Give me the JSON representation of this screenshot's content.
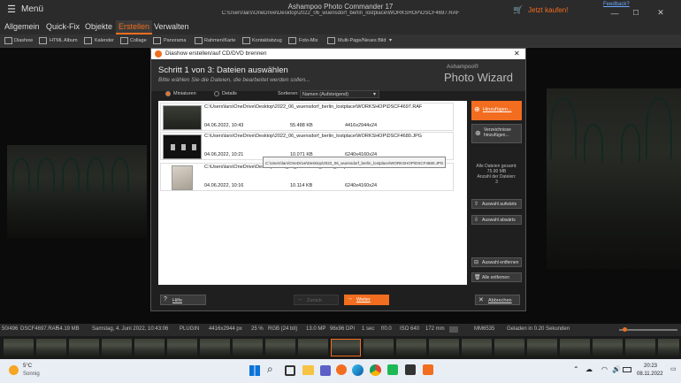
{
  "app": {
    "menu_label": "Menü",
    "window_title": "Ashampoo Photo Commander 17",
    "file_path": "C:\\Users\\lars\\OneDrive\\Desktop\\2022_06_wuensdorf_berlin_lostplace\\WORKSHOP\\DSCF4697.RAF",
    "buy_label": "Jetzt kaufen!",
    "feedback_label": "Feedback?"
  },
  "menu": [
    "Allgemein",
    "Quick-Fix",
    "Objekte",
    "Erstellen",
    "Verwalten"
  ],
  "toolbar": [
    "Diashow",
    "HTML Album",
    "Kalender",
    "Collage",
    "Panorama",
    "Rahmen/Karte",
    "Kontaktabzug",
    "Foto-Mix",
    "Multi-Page/Neues Bild"
  ],
  "dialog": {
    "title": "Diashow erstellen/auf CD/DVD brennen",
    "step": "Schritt 1 von 3: Dateien auswählen",
    "subtitle": "Bitte wählen Sie die Dateien, die bearbeitet werden sollen...",
    "brand_small": "Ashampoo®",
    "brand_large": "Photo Wizard",
    "view_thumbs": "Miniaturen",
    "view_details": "Details",
    "sort_label": "Sortieren:",
    "sort_value": "Namen (Aufsteigend)",
    "files": [
      {
        "path": "C:\\Users\\lars\\OneDrive\\Desktop\\2022_06_wuensdorf_berlin_lostplace\\WORKSHOP\\DSCF4697.RAF",
        "date": "04.06.2022, 10:43",
        "size": "55.488 KB",
        "dims": "4416x2944x24"
      },
      {
        "path": "C:\\Users\\lars\\OneDrive\\Desktop\\2022_06_wuensdorf_berlin_lostplace\\WORKSHOP\\DSCF4680.JPG",
        "date": "04.06.2022, 10:21",
        "size": "10.071 KB",
        "dims": "6240x4160x24"
      },
      {
        "path": "C:\\Users\\lars\\OneDrive\\Desktop\\2022_06_wuensdorf_berlin_lostplace\\WORKSHOP\\DSCF4673.JPG",
        "date": "04.06.2022, 10:16",
        "size": "10.114 KB",
        "dims": "6240x4160x24"
      }
    ],
    "tooltip": "C:\\Users\\lars\\OneDrive\\Desktop\\2022_06_wuensdorf_berlin_lostplace\\WORKSHOP\\DSCF4680.JPG",
    "add_files": "Hinzufügen...",
    "add_folder": "Verzeichnisse hinzufügen...",
    "info_all": "Alle Dateien gesamt:",
    "info_size": "75.90 MB",
    "info_count_label": "Anzahl der Dateien:",
    "info_count": "3",
    "move_up": "Auswahl aufwärts",
    "move_down": "Auswahl abwärts",
    "remove_sel": "Auswahl entfernen",
    "remove_all": "Alle entfernen",
    "help": "Hilfe",
    "back": "Zurück",
    "next": "Weiter",
    "cancel": "Abbrechen"
  },
  "status": {
    "index": "50/496",
    "file": "DSCF4697.RAF",
    "size": "54.19 MB",
    "date": "Samstag, 4. Juni 2022, 10:43:06",
    "plugin": "PLUGIN",
    "dims": "4416x2944 px",
    "zoom": "25 %",
    "color": "RGB (24 bit)",
    "mp": "13.0 MP",
    "dpi": "96x96 DPI",
    "exposure": "1 sec",
    "aperture": "f/0.0",
    "iso": "ISO 640",
    "focal": "172 mm",
    "camera": "MM6535",
    "loaded": "Geladen in 0.20 Sekunden"
  },
  "taskbar": {
    "temp": "5°C",
    "weather": "Sonnig",
    "search_hint": "Suche",
    "time": "20:23",
    "date": "08.11.2022"
  },
  "colors": {
    "accent": "#f26d1f"
  }
}
